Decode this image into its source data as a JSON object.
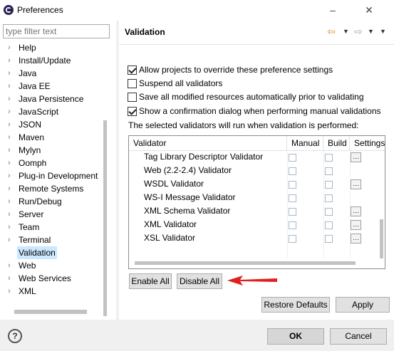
{
  "window": {
    "title": "Preferences",
    "minimize": "‒",
    "close": "✕"
  },
  "filter": {
    "placeholder": "type filter text"
  },
  "tree": [
    {
      "label": "Help",
      "expandable": true
    },
    {
      "label": "Install/Update",
      "expandable": true
    },
    {
      "label": "Java",
      "expandable": true
    },
    {
      "label": "Java EE",
      "expandable": true
    },
    {
      "label": "Java Persistence",
      "expandable": true
    },
    {
      "label": "JavaScript",
      "expandable": true
    },
    {
      "label": "JSON",
      "expandable": true
    },
    {
      "label": "Maven",
      "expandable": true
    },
    {
      "label": "Mylyn",
      "expandable": true
    },
    {
      "label": "Oomph",
      "expandable": true
    },
    {
      "label": "Plug-in Development",
      "expandable": true
    },
    {
      "label": "Remote Systems",
      "expandable": true
    },
    {
      "label": "Run/Debug",
      "expandable": true
    },
    {
      "label": "Server",
      "expandable": true
    },
    {
      "label": "Team",
      "expandable": true
    },
    {
      "label": "Terminal",
      "expandable": true
    },
    {
      "label": "Validation",
      "expandable": false,
      "selected": true
    },
    {
      "label": "Web",
      "expandable": true
    },
    {
      "label": "Web Services",
      "expandable": true
    },
    {
      "label": "XML",
      "expandable": true
    }
  ],
  "page": {
    "title": "Validation",
    "options": [
      {
        "label": "Allow projects to override these preference settings",
        "checked": true
      },
      {
        "label": "Suspend all validators",
        "checked": false
      },
      {
        "label": "Save all modified resources automatically prior to validating",
        "checked": false
      },
      {
        "label": "Show a confirmation dialog when performing manual validations",
        "checked": true
      }
    ],
    "info": "The selected validators will run when validation is performed:",
    "table": {
      "columns": [
        "Validator",
        "Manual",
        "Build",
        "Settings"
      ],
      "rows": [
        {
          "name": "Tag Library Descriptor Validator",
          "manual": false,
          "build": false,
          "settings": true
        },
        {
          "name": "Web (2.2-2.4) Validator",
          "manual": false,
          "build": false,
          "settings": false
        },
        {
          "name": "WSDL Validator",
          "manual": false,
          "build": false,
          "settings": true
        },
        {
          "name": "WS-I Message Validator",
          "manual": false,
          "build": false,
          "settings": false
        },
        {
          "name": "XML Schema Validator",
          "manual": false,
          "build": false,
          "settings": true
        },
        {
          "name": "XML Validator",
          "manual": false,
          "build": false,
          "settings": true
        },
        {
          "name": "XSL Validator",
          "manual": false,
          "build": false,
          "settings": true
        }
      ]
    },
    "enable_all": "Enable All",
    "disable_all": "Disable All",
    "restore_defaults": "Restore Defaults",
    "apply": "Apply"
  },
  "footer": {
    "help": "?",
    "ok": "OK",
    "cancel": "Cancel"
  },
  "colors": {
    "selection": "#cce8ff",
    "annotation_arrow": "#e02020"
  }
}
